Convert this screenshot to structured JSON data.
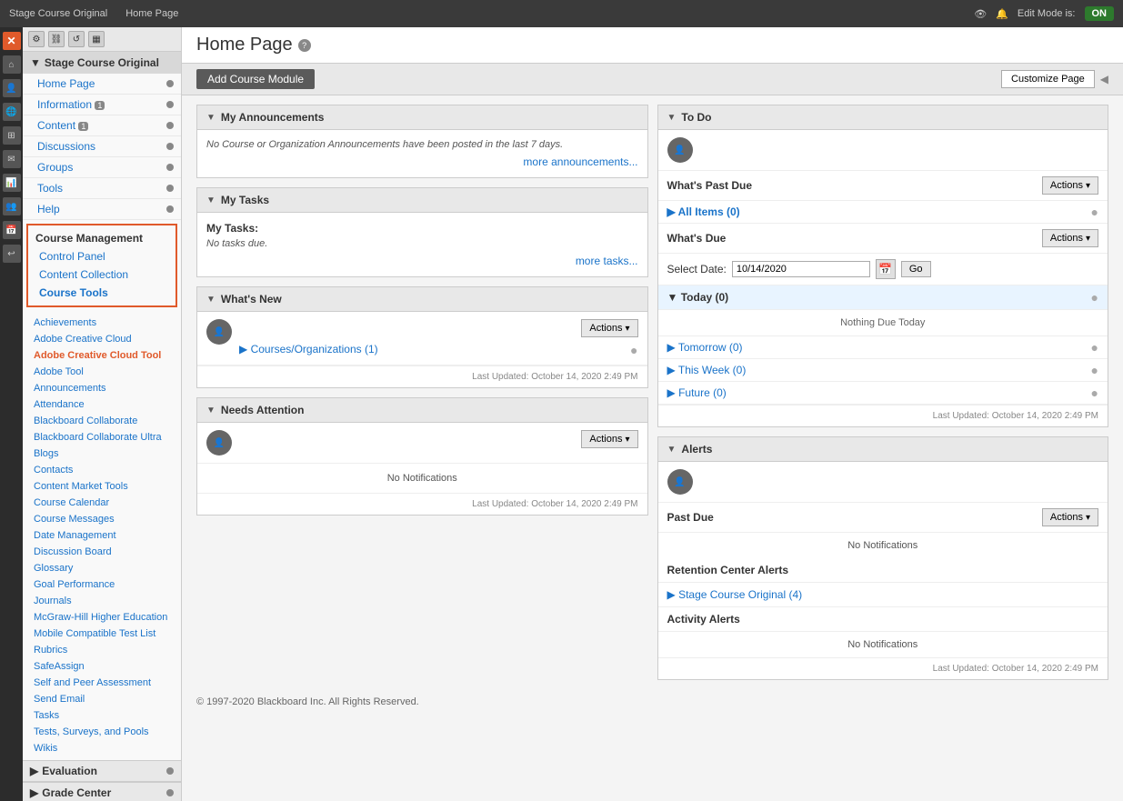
{
  "topbar": {
    "course_title": "Stage Course Original",
    "page_title": "Home Page",
    "edit_mode_label": "Edit Mode is:",
    "edit_mode_status": "ON"
  },
  "sidebar": {
    "toolbar_buttons": [
      "settings",
      "link",
      "refresh",
      "layout"
    ],
    "course_name": "Stage Course Original",
    "items": [
      {
        "label": "Home Page",
        "has_dot": true
      },
      {
        "label": "Information",
        "has_badge": true,
        "badge": "1",
        "has_dot": true
      },
      {
        "label": "Content",
        "has_badge": true,
        "badge": "1",
        "has_dot": true
      },
      {
        "label": "Discussions",
        "has_dot": true
      },
      {
        "label": "Groups",
        "has_dot": true
      },
      {
        "label": "Tools",
        "has_dot": true
      },
      {
        "label": "Help",
        "has_dot": true
      }
    ],
    "course_management": {
      "title": "Course Management",
      "control_panel": "Control Panel",
      "content_collection": "Content Collection",
      "course_tools": "Course Tools"
    },
    "tools_list": [
      "Achievements",
      "Adobe Creative Cloud",
      "Adobe Creative Cloud Tool",
      "Adobe Tool",
      "Announcements",
      "Attendance",
      "Blackboard Collaborate",
      "Blackboard Collaborate Ultra",
      "Blogs",
      "Contacts",
      "Content Market Tools",
      "Course Calendar",
      "Course Messages",
      "Date Management",
      "Discussion Board",
      "Glossary",
      "Goal Performance",
      "Journals",
      "McGraw-Hill Higher Education",
      "Mobile Compatible Test List",
      "Rubrics",
      "SafeAssign",
      "Self and Peer Assessment",
      "Send Email",
      "Tasks",
      "Tests, Surveys, and Pools",
      "Wikis"
    ],
    "evaluation_label": "Evaluation",
    "grade_center_label": "Grade Center"
  },
  "main": {
    "title": "Home Page",
    "add_module_label": "Add Course Module",
    "customize_label": "Customize Page",
    "panels": {
      "announcements": {
        "title": "My Announcements",
        "empty_text": "No Course or Organization Announcements have been posted in the last 7 days.",
        "more_link": "more announcements..."
      },
      "tasks": {
        "title": "My Tasks",
        "tasks_label": "My Tasks:",
        "empty_text": "No tasks due.",
        "more_link": "more tasks..."
      },
      "whats_new": {
        "title": "What's New",
        "courses_label": "Courses/Organizations",
        "courses_count": "(1)",
        "last_updated": "Last Updated: October 14, 2020 2:49 PM"
      },
      "needs_attention": {
        "title": "Needs Attention",
        "empty_text": "No Notifications",
        "last_updated": "Last Updated: October 14, 2020 2:49 PM"
      },
      "todo": {
        "title": "To Do",
        "whats_past_due": "What's Past Due",
        "all_items_label": "All Items",
        "all_items_count": "(0)",
        "whats_due": "What's Due",
        "select_date_label": "Select Date:",
        "date_value": "10/14/2020",
        "go_label": "Go",
        "today_label": "Today",
        "today_count": "(0)",
        "nothing_today": "Nothing Due Today",
        "tomorrow_label": "Tomorrow",
        "tomorrow_count": "(0)",
        "this_week_label": "This Week",
        "this_week_count": "(0)",
        "future_label": "Future",
        "future_count": "(0)",
        "last_updated": "Last Updated: October 14, 2020 2:49 PM"
      },
      "alerts": {
        "title": "Alerts",
        "past_due": "Past Due",
        "no_notifications": "No Notifications",
        "retention_center": "Retention Center Alerts",
        "stage_course_link": "Stage Course Original",
        "stage_course_count": "(4)",
        "activity_alerts": "Activity Alerts",
        "no_activity": "No Notifications",
        "last_updated": "Last Updated: October 14, 2020 2:49 PM"
      }
    }
  },
  "footer": {
    "copyright": "© 1997-2020 Blackboard Inc. All Rights Reserved."
  }
}
